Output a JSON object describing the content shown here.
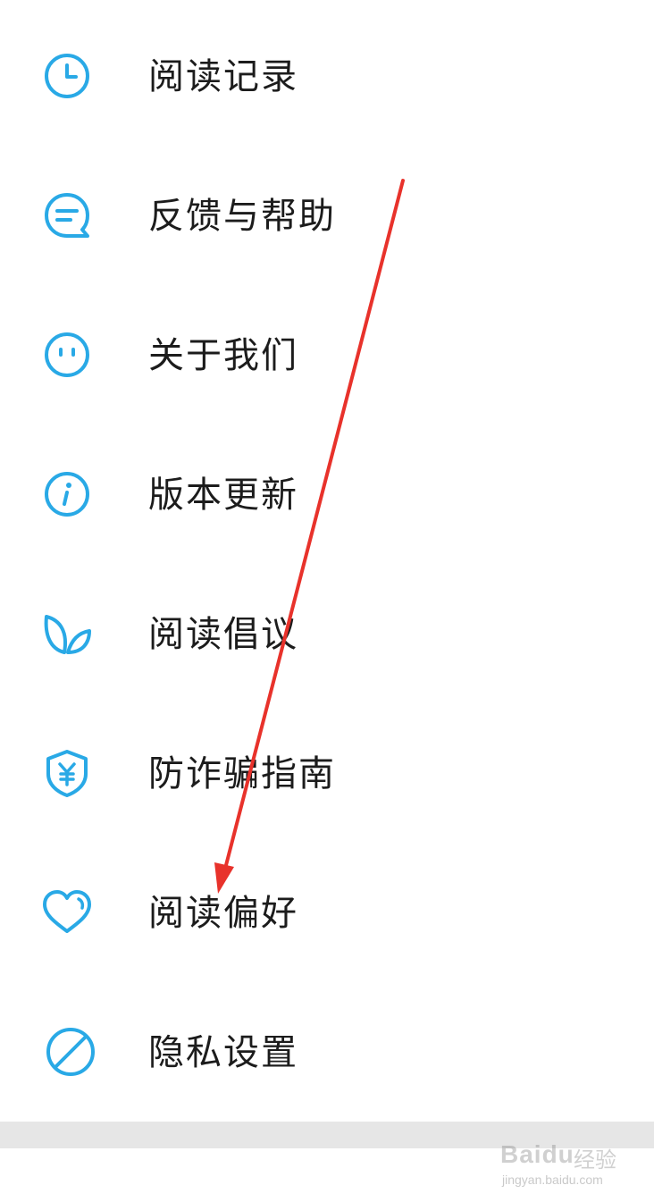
{
  "accent_color": "#29a9e6",
  "annotation_color": "#e8322b",
  "menu": {
    "items": [
      {
        "label": "阅读记录",
        "icon": "clock-icon"
      },
      {
        "label": "反馈与帮助",
        "icon": "chat-bubble-icon"
      },
      {
        "label": "关于我们",
        "icon": "smiley-face-icon"
      },
      {
        "label": "版本更新",
        "icon": "info-icon"
      },
      {
        "label": "阅读倡议",
        "icon": "leaf-icon"
      },
      {
        "label": "防诈骗指南",
        "icon": "shield-yen-icon"
      },
      {
        "label": "阅读偏好",
        "icon": "heart-icon"
      },
      {
        "label": "隐私设置",
        "icon": "forbidden-circle-icon"
      }
    ]
  },
  "watermark": {
    "logo": "Baidu",
    "text": "经验",
    "url": "jingyan.baidu.com"
  }
}
